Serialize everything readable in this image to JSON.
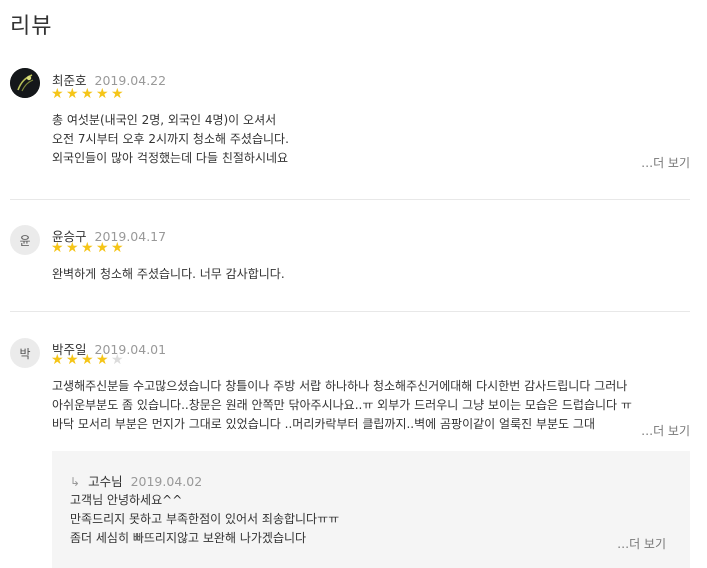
{
  "page": {
    "title": "리뷰"
  },
  "reviews": [
    {
      "avatar": "photo",
      "author": "최준호",
      "date": "2019.04.22",
      "rating": 5,
      "lines": [
        "총 여섯분(내국인 2명, 외국인 4명)이 오셔서",
        "오전 7시부터 오후 2시까지 청소해 주셨습니다.",
        "외국인들이 많아 걱정했는데 다들 친절하시네요"
      ],
      "more_label": "…더 보기"
    },
    {
      "avatar": "윤",
      "author": "윤승구",
      "date": "2019.04.17",
      "rating": 5,
      "lines": [
        "완벽하게 청소해 주셨습니다. 너무 감사합니다."
      ]
    },
    {
      "avatar": "박",
      "author": "박주일",
      "date": "2019.04.01",
      "rating": 4,
      "lines": [
        "고생해주신분들 수고많으셨습니다 창틀이나 주방 서랍 하나하나 청소해주신거에대해 다시한번 감사드립니다 그러나",
        "아쉬운부분도 좀 있습니다..창문은 원래 안쪽만 닦아주시나요..ㅠ 외부가 드러우니 그냥 보이는 모습은 드럽습니다 ㅠ",
        "바닥 모서리 부분은 먼지가 그대로 있었습니다 ..머리카락부터 클립까지..벽에 곰팡이같이 얼룩진 부분도 그대"
      ],
      "more_label": "…더 보기",
      "reply": {
        "arrow": "↳",
        "author": "고수님",
        "date": "2019.04.02",
        "lines": [
          "고객님 안녕하세요^^",
          "만족드리지 못하고 부족한점이 있어서 죄송합니다ㅠㅠ",
          "좀더 세심히 빠뜨리지않고 보완해 나가겠습니다"
        ],
        "more_label": "…더 보기"
      }
    }
  ],
  "colors": {
    "star": "#f5c518",
    "star_empty": "#dcdcdc",
    "date": "#999999",
    "reply_bg": "#f5f5f5"
  },
  "icons": {
    "star": "star-icon",
    "reply": "reply-arrow-icon"
  }
}
